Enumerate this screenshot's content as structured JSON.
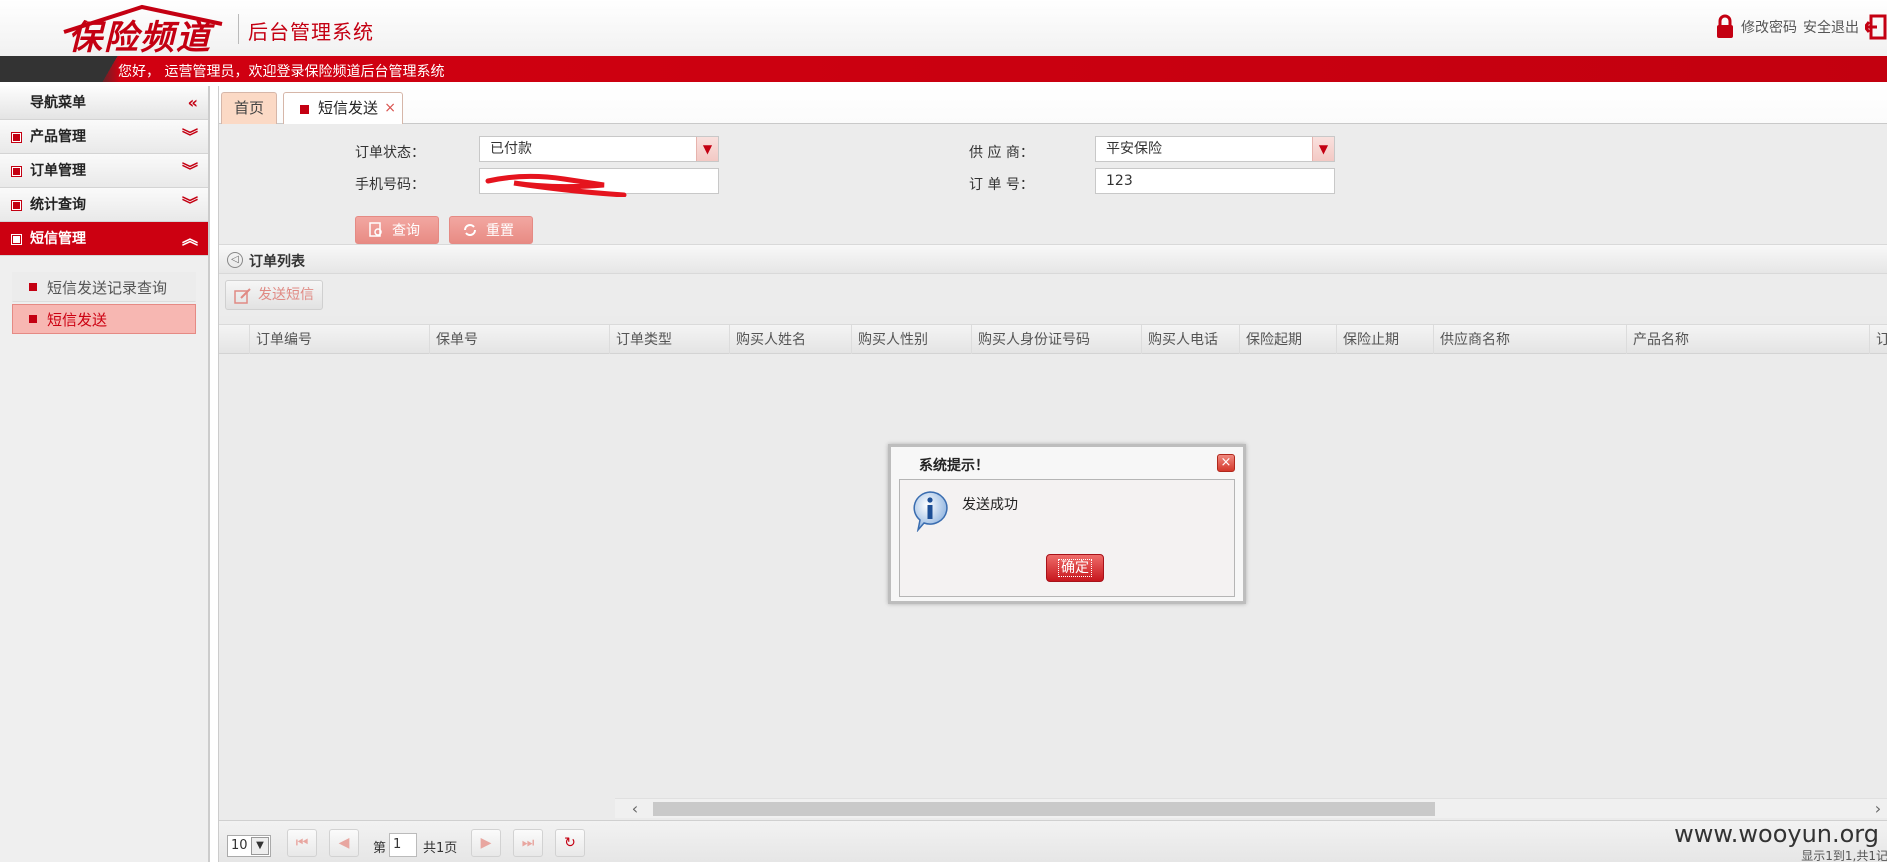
{
  "header": {
    "logo_text": "保险频道",
    "system_title": "后台管理系统",
    "change_password": "修改密码",
    "logout": "安全退出",
    "welcome": "您好， 运营管理员，欢迎登录保险频道后台管理系统"
  },
  "sidebar": {
    "title": "导航菜单",
    "items": [
      {
        "label": "产品管理"
      },
      {
        "label": "订单管理"
      },
      {
        "label": "统计查询"
      },
      {
        "label": "短信管理"
      }
    ],
    "sub_items": [
      {
        "label": "短信发送记录查询"
      },
      {
        "label": "短信发送"
      }
    ]
  },
  "tabs": {
    "home": "首页",
    "sms_send": "短信发送",
    "close": "×"
  },
  "search": {
    "order_status_label": "订单状态：",
    "order_status_value": "已付款",
    "phone_label": "手机号码：",
    "phone_value": "",
    "supplier_label": "供 应 商：",
    "supplier_value": "平安保险",
    "order_no_label": "订 单 号：",
    "order_no_value": "123",
    "query_button": "查询",
    "reset_button": "重置"
  },
  "list": {
    "title": "订单列表",
    "send_sms_button": "发送短信",
    "columns": [
      "订单编号",
      "保单号",
      "订单类型",
      "购买人姓名",
      "购买人性别",
      "购买人身份证号码",
      "购买人电话",
      "保险起期",
      "保险止期",
      "供应商名称",
      "产品名称",
      "订"
    ]
  },
  "pager": {
    "page_size": "10",
    "page_prefix": "第",
    "page_number": "1",
    "page_total": "共1页",
    "info": "显示1到1,共1记"
  },
  "dialog": {
    "title": "系统提示！",
    "message": "发送成功",
    "ok_button": "确定",
    "close": "×"
  },
  "watermark": "www.wooyun.org",
  "colors": {
    "brand_red": "#c40012",
    "light_red": "#f7b7b2"
  }
}
